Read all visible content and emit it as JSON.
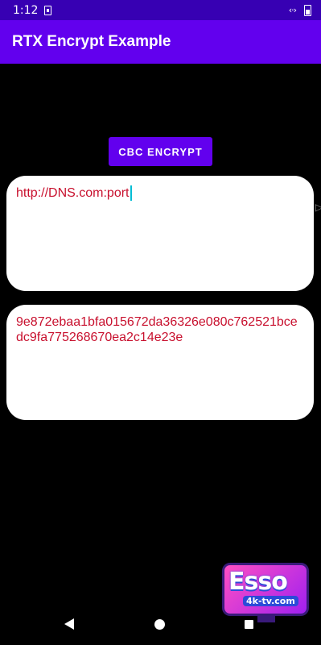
{
  "status_bar": {
    "time": "1:12"
  },
  "app_bar": {
    "title": "RTX Encrypt Example"
  },
  "encrypt_button": {
    "label": "CBC ENCRYPT"
  },
  "input_field": {
    "value": "http://DNS.com:port"
  },
  "output_field": {
    "value": "9e872ebaa1bfa015672da36326e080c762521bcedc9fa775268670ea2c14e23e"
  },
  "watermark": {
    "title": "Esso",
    "subtitle": "4k-tv.com"
  },
  "colors": {
    "status_bar": "#3700b3",
    "app_bar": "#6200ee",
    "button": "#6200ee",
    "text": "#c8102e",
    "cursor": "#00bcd4",
    "background": "#000000"
  }
}
